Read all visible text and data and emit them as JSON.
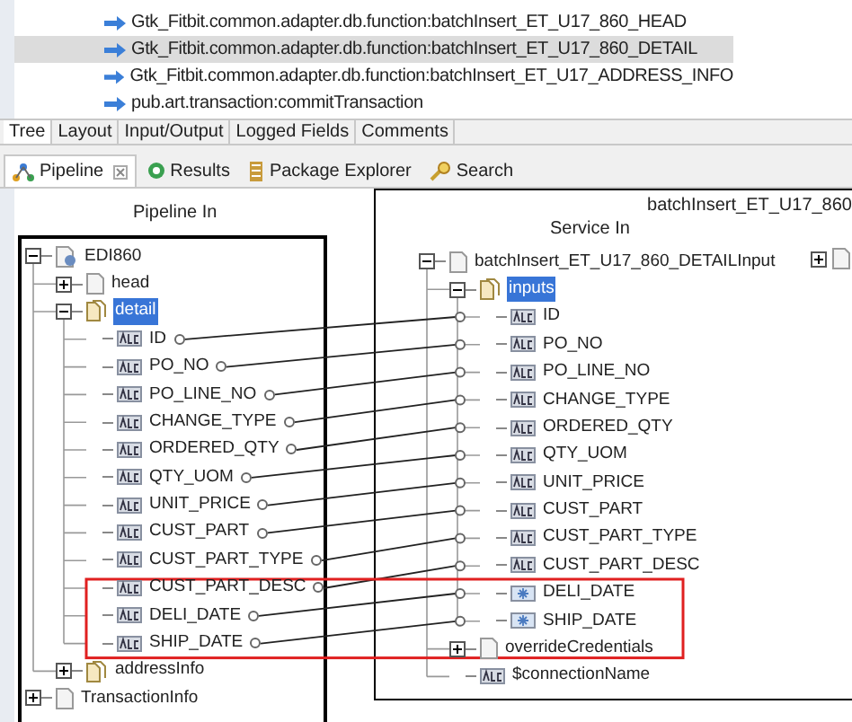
{
  "services": [
    {
      "text": "Gtk_Fitbit.common.adapter.db.function:batchInsert_ET_U17_860_HEAD",
      "selected": false
    },
    {
      "text": "Gtk_Fitbit.common.adapter.db.function:batchInsert_ET_U17_860_DETAIL",
      "selected": true
    },
    {
      "text": "Gtk_Fitbit.common.adapter.db.function:batchInsert_ET_U17_ADDRESS_INFO",
      "selected": false
    },
    {
      "text": "pub.art.transaction:commitTransaction",
      "selected": false
    }
  ],
  "editor_tabs": [
    {
      "label": "Tree",
      "selected": true
    },
    {
      "label": "Layout",
      "selected": false
    },
    {
      "label": "Input/Output",
      "selected": false
    },
    {
      "label": "Logged Fields",
      "selected": false
    },
    {
      "label": "Comments",
      "selected": false
    }
  ],
  "views": [
    {
      "label": "Pipeline",
      "kind": "pipeline",
      "selected": true
    },
    {
      "label": "Results",
      "kind": "results",
      "selected": false
    },
    {
      "label": "Package Explorer",
      "kind": "package",
      "selected": false
    },
    {
      "label": "Search",
      "kind": "search",
      "selected": false
    }
  ],
  "pipeline_in": {
    "title": "Pipeline In",
    "tree": [
      {
        "label": "EDI860",
        "kind": "record",
        "expanded": true,
        "selected": false,
        "children": [
          {
            "label": "head",
            "kind": "document",
            "expanded": false,
            "selected": false
          },
          {
            "label": "detail",
            "kind": "list",
            "expanded": true,
            "selected": true,
            "children": [
              {
                "label": "ID",
                "kind": "string",
                "mapped": true,
                "highlighted": false
              },
              {
                "label": "PO_NO",
                "kind": "string",
                "mapped": true,
                "highlighted": false
              },
              {
                "label": "PO_LINE_NO",
                "kind": "string",
                "mapped": true,
                "highlighted": false
              },
              {
                "label": "CHANGE_TYPE",
                "kind": "string",
                "mapped": true,
                "highlighted": false
              },
              {
                "label": "ORDERED_QTY",
                "kind": "string",
                "mapped": true,
                "highlighted": false
              },
              {
                "label": "QTY_UOM",
                "kind": "string",
                "mapped": true,
                "highlighted": false
              },
              {
                "label": "UNIT_PRICE",
                "kind": "string",
                "mapped": true,
                "highlighted": false
              },
              {
                "label": "CUST_PART",
                "kind": "string",
                "mapped": true,
                "highlighted": false
              },
              {
                "label": "CUST_PART_TYPE",
                "kind": "string",
                "mapped": true,
                "highlighted": false
              },
              {
                "label": "CUST_PART_DESC",
                "kind": "string",
                "mapped": true,
                "highlighted": false
              },
              {
                "label": "DELI_DATE",
                "kind": "string",
                "mapped": true,
                "highlighted": true
              },
              {
                "label": "SHIP_DATE",
                "kind": "string",
                "mapped": true,
                "highlighted": true
              }
            ]
          },
          {
            "label": "addressInfo",
            "kind": "list",
            "expanded": false,
            "selected": false
          }
        ]
      },
      {
        "label": "TransactionInfo",
        "kind": "document",
        "expanded": false,
        "selected": false
      }
    ]
  },
  "service_in": {
    "service_name": "batchInsert_ET_U17_860",
    "title": "Service In",
    "tree": [
      {
        "label": "batchInsert_ET_U17_860_DETAILInput",
        "kind": "document",
        "expanded": true,
        "selected": false,
        "children": [
          {
            "label": "inputs",
            "kind": "list",
            "expanded": true,
            "selected": true,
            "children": [
              {
                "label": "ID",
                "kind": "string"
              },
              {
                "label": "PO_NO",
                "kind": "string"
              },
              {
                "label": "PO_LINE_NO",
                "kind": "string"
              },
              {
                "label": "CHANGE_TYPE",
                "kind": "string"
              },
              {
                "label": "ORDERED_QTY",
                "kind": "string"
              },
              {
                "label": "QTY_UOM",
                "kind": "string"
              },
              {
                "label": "UNIT_PRICE",
                "kind": "string"
              },
              {
                "label": "CUST_PART",
                "kind": "string"
              },
              {
                "label": "CUST_PART_TYPE",
                "kind": "string"
              },
              {
                "label": "CUST_PART_DESC",
                "kind": "string"
              },
              {
                "label": "DELI_DATE",
                "kind": "object"
              },
              {
                "label": "SHIP_DATE",
                "kind": "object"
              }
            ]
          },
          {
            "label": "overrideCredentials",
            "kind": "document",
            "expanded": false,
            "selected": false
          },
          {
            "label": "$connectionName",
            "kind": "string"
          }
        ]
      }
    ]
  }
}
